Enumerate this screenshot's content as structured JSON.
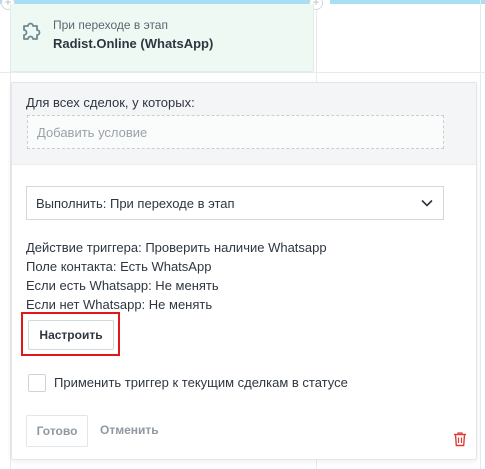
{
  "stage": {
    "caption": "При переходе в этап",
    "name": "Radist.Online (WhatsApp)",
    "icon": "puzzle-icon"
  },
  "conditions": {
    "label": "Для всех сделок, у которых:",
    "add_placeholder": "Добавить условие"
  },
  "execute": {
    "selected": "Выполнить: При переходе в этап"
  },
  "info": [
    "Действие триггера: Проверить наличие Whatsapp",
    "Поле контакта: Есть WhatsApp",
    "Если есть Whatsapp: Не менять",
    "Если нет Whatsapp: Не менять"
  ],
  "setup_button": "Настроить",
  "apply_checkbox": {
    "label": "Применить триггер к текущим сделкам в статусе",
    "checked": false
  },
  "footer": {
    "done": "Готово",
    "cancel": "Отменить"
  },
  "colors": {
    "highlight": "#e21818",
    "stage_bg": "#eff9f3",
    "stage_icon": "#6b8a94",
    "topbar": "#a9dff4",
    "trash": "#e53935"
  }
}
